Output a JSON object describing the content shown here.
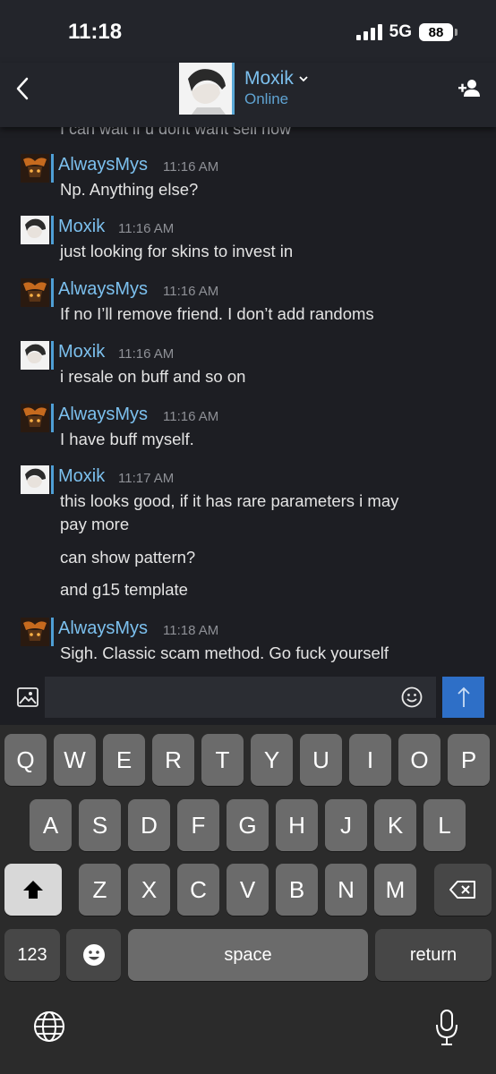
{
  "status_bar": {
    "time": "11:18",
    "network": "5G",
    "battery": "88"
  },
  "header": {
    "contact_name": "Moxik",
    "contact_status": "Online"
  },
  "chat": {
    "cutoff_text": "I can wait if u dont want sell now",
    "groups": [
      {
        "sender": "AlwaysMys",
        "time": "11:16 AM",
        "lines": [
          "Np. Anything else?"
        ]
      },
      {
        "sender": "Moxik",
        "time": "11:16 AM",
        "lines": [
          "just looking for skins to invest in"
        ]
      },
      {
        "sender": "AlwaysMys",
        "time": "11:16 AM",
        "lines": [
          "If no I’ll remove friend. I don’t add randoms"
        ]
      },
      {
        "sender": "Moxik",
        "time": "11:16 AM",
        "lines": [
          "i resale on buff and so on"
        ]
      },
      {
        "sender": "AlwaysMys",
        "time": "11:16 AM",
        "lines": [
          "I have buff myself."
        ]
      },
      {
        "sender": "Moxik",
        "time": "11:17 AM",
        "lines": [
          "this looks good, if it has rare parameters i may",
          "pay more",
          "can show pattern?",
          "and g15 template"
        ]
      },
      {
        "sender": "AlwaysMys",
        "time": "11:18 AM",
        "lines": [
          "Sigh. Classic scam method. Go fuck yourself"
        ]
      }
    ]
  },
  "keyboard": {
    "row1": [
      "Q",
      "W",
      "E",
      "R",
      "T",
      "Y",
      "U",
      "I",
      "O",
      "P"
    ],
    "row2": [
      "A",
      "S",
      "D",
      "F",
      "G",
      "H",
      "J",
      "K",
      "L"
    ],
    "row3": [
      "Z",
      "X",
      "C",
      "V",
      "B",
      "N",
      "M"
    ],
    "numbers_label": "123",
    "space_label": "space",
    "return_label": "return"
  },
  "colors": {
    "moxik_name": "#7cc0ee",
    "alwaysmys_name": "#7cc0ee",
    "send_button": "#2e6fc7"
  }
}
